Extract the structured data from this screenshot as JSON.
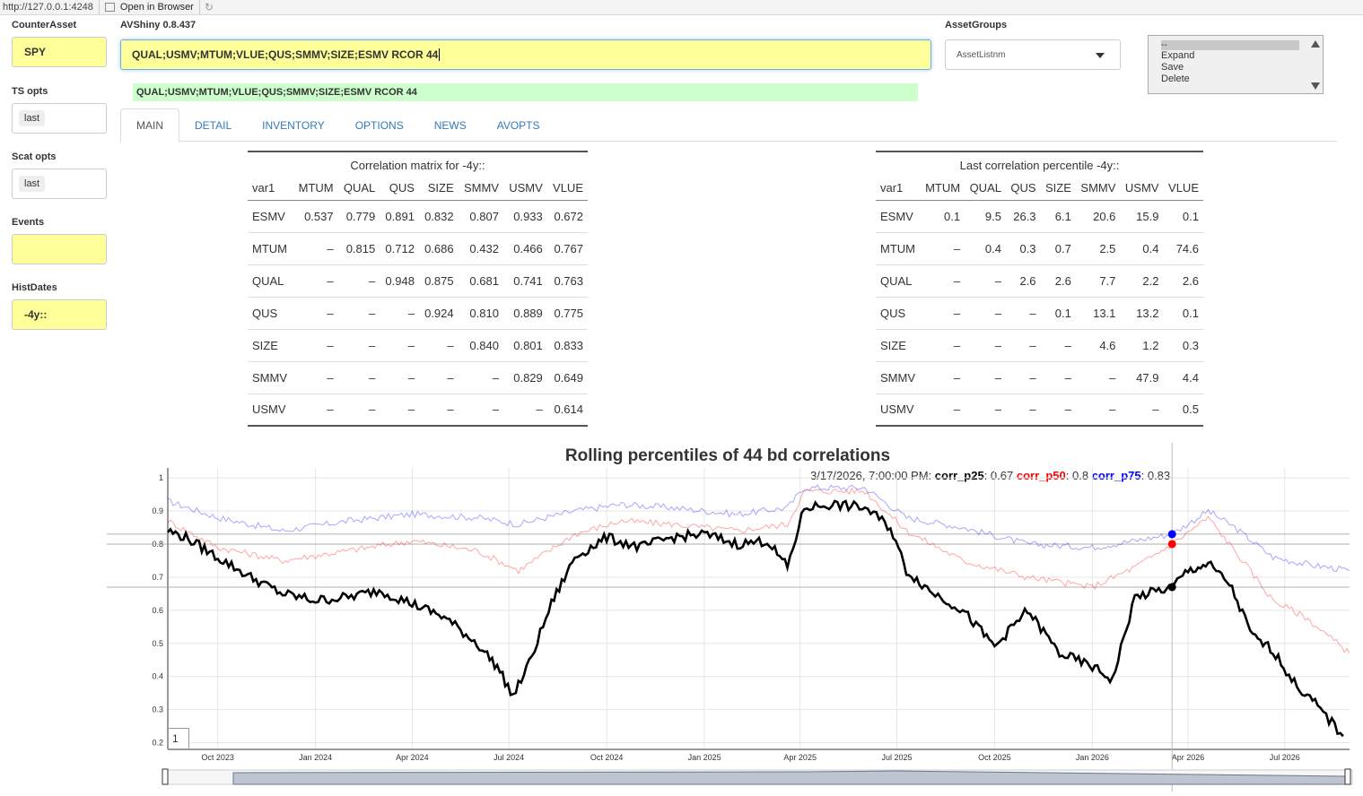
{
  "browser": {
    "url": "http://127.0.0.1:4248",
    "open_in_browser": "Open in Browser"
  },
  "sidebar": {
    "counter_asset_label": "CounterAsset",
    "counter_asset_value": "SPY",
    "ts_opts_label": "TS opts",
    "ts_opts_value": "last",
    "scat_opts_label": "Scat opts",
    "scat_opts_value": "last",
    "events_label": "Events",
    "events_value": "",
    "histdates_label": "HistDates",
    "histdates_value": "-4y::"
  },
  "app": {
    "title": "AVShiny 0.8.437",
    "command": "QUAL;USMV;MTUM;VLUE;QUS;SMMV;SIZE;ESMV RCOR 44",
    "echo": "QUAL;USMV;MTUM;VLUE;QUS;SMMV;SIZE;ESMV RCOR 44"
  },
  "asset_groups": {
    "label": "AssetGroups",
    "selected": "AssetListnm"
  },
  "listbox": {
    "items": [
      "--",
      "Expand",
      "Save",
      "Delete"
    ]
  },
  "tabs": [
    "MAIN",
    "DETAIL",
    "INVENTORY",
    "OPTIONS",
    "NEWS",
    "AVOPTS"
  ],
  "corr_table": {
    "caption": "Correlation matrix for -4y::",
    "headers": [
      "var1",
      "MTUM",
      "QUAL",
      "QUS",
      "SIZE",
      "SMMV",
      "USMV",
      "VLUE"
    ],
    "rows": [
      [
        "ESMV",
        "0.537",
        "0.779",
        "0.891",
        "0.832",
        "0.807",
        "0.933",
        "0.672"
      ],
      [
        "MTUM",
        "–",
        "0.815",
        "0.712",
        "0.686",
        "0.432",
        "0.466",
        "0.767"
      ],
      [
        "QUAL",
        "–",
        "–",
        "0.948",
        "0.875",
        "0.681",
        "0.741",
        "0.763"
      ],
      [
        "QUS",
        "–",
        "–",
        "–",
        "0.924",
        "0.810",
        "0.889",
        "0.775"
      ],
      [
        "SIZE",
        "–",
        "–",
        "–",
        "–",
        "0.840",
        "0.801",
        "0.833"
      ],
      [
        "SMMV",
        "–",
        "–",
        "–",
        "–",
        "–",
        "0.829",
        "0.649"
      ],
      [
        "USMV",
        "–",
        "–",
        "–",
        "–",
        "–",
        "–",
        "0.614"
      ]
    ]
  },
  "pct_table": {
    "caption": "Last correlation percentile -4y::",
    "headers": [
      "var1",
      "MTUM",
      "QUAL",
      "QUS",
      "SIZE",
      "SMMV",
      "USMV",
      "VLUE"
    ],
    "rows": [
      [
        "ESMV",
        "0.1",
        "9.5",
        "26.3",
        "6.1",
        "20.6",
        "15.9",
        "0.1"
      ],
      [
        "MTUM",
        "–",
        "0.4",
        "0.3",
        "0.7",
        "2.5",
        "0.4",
        "74.6"
      ],
      [
        "QUAL",
        "–",
        "–",
        "2.6",
        "2.6",
        "7.7",
        "2.2",
        "2.6"
      ],
      [
        "QUS",
        "–",
        "–",
        "–",
        "0.1",
        "13.1",
        "13.2",
        "0.1"
      ],
      [
        "SIZE",
        "–",
        "–",
        "–",
        "–",
        "4.6",
        "1.2",
        "0.3"
      ],
      [
        "SMMV",
        "–",
        "–",
        "–",
        "–",
        "–",
        "47.9",
        "4.4"
      ],
      [
        "USMV",
        "–",
        "–",
        "–",
        "–",
        "–",
        "–",
        "0.5"
      ]
    ]
  },
  "chart_data": {
    "type": "line",
    "title": "Rolling percentiles of 44 bd correlations",
    "legend": {
      "date": "3/17/2026, 7:00:00 PM:",
      "entries": [
        {
          "name": "corr_p25",
          "value": "0.67",
          "color": "#000000"
        },
        {
          "name": "corr_p50",
          "value": "0.8",
          "color": "#ff0000"
        },
        {
          "name": "corr_p75",
          "value": "0.83",
          "color": "#0000ff"
        }
      ]
    },
    "range_selector_label": "1",
    "ylim": [
      0.18,
      1.03
    ],
    "yticks": [
      1,
      0.9,
      0.8,
      0.7,
      0.6,
      0.5,
      0.4,
      0.3,
      0.2
    ],
    "xticks": [
      "Oct 2023",
      "Jan 2024",
      "Apr 2024",
      "Jul 2024",
      "Oct 2024",
      "Jan 2025",
      "Apr 2025",
      "Jul 2025",
      "Oct 2025",
      "Jan 2026",
      "Apr 2026",
      "Jul 2026"
    ],
    "x_month_range": [
      "2023-08-15",
      "2026-08-31"
    ],
    "highlight_x": "2026-03-17",
    "series": [
      {
        "name": "corr_p25",
        "color": "#000000",
        "x": [
          "2023-08-15",
          "2023-09-01",
          "2023-10-01",
          "2023-11-01",
          "2023-12-01",
          "2024-01-01",
          "2024-02-01",
          "2024-03-01",
          "2024-04-01",
          "2024-05-01",
          "2024-06-01",
          "2024-06-20",
          "2024-07-05",
          "2024-07-20",
          "2024-08-10",
          "2024-09-01",
          "2024-10-01",
          "2024-11-01",
          "2024-12-01",
          "2025-01-01",
          "2025-02-01",
          "2025-03-01",
          "2025-03-20",
          "2025-04-05",
          "2025-05-01",
          "2025-06-01",
          "2025-06-25",
          "2025-07-10",
          "2025-08-01",
          "2025-09-01",
          "2025-10-01",
          "2025-11-01",
          "2025-12-01",
          "2026-01-01",
          "2026-01-20",
          "2026-02-10",
          "2026-03-17",
          "2026-04-01",
          "2026-04-20",
          "2026-05-10",
          "2026-06-01",
          "2026-06-20",
          "2026-07-10",
          "2026-08-01",
          "2026-08-25"
        ],
        "values": [
          0.84,
          0.82,
          0.76,
          0.7,
          0.65,
          0.63,
          0.64,
          0.66,
          0.62,
          0.58,
          0.5,
          0.43,
          0.34,
          0.44,
          0.62,
          0.76,
          0.82,
          0.79,
          0.82,
          0.83,
          0.8,
          0.81,
          0.73,
          0.91,
          0.92,
          0.91,
          0.85,
          0.72,
          0.66,
          0.6,
          0.49,
          0.6,
          0.47,
          0.43,
          0.39,
          0.64,
          0.67,
          0.72,
          0.74,
          0.68,
          0.52,
          0.48,
          0.38,
          0.31,
          0.22
        ]
      },
      {
        "name": "corr_p50",
        "color": "#ff0000",
        "x": [
          "2023-08-15",
          "2023-10-01",
          "2023-12-01",
          "2024-02-01",
          "2024-04-01",
          "2024-06-01",
          "2024-07-10",
          "2024-09-01",
          "2024-10-15",
          "2024-12-01",
          "2025-02-01",
          "2025-03-20",
          "2025-04-05",
          "2025-06-01",
          "2025-07-10",
          "2025-09-01",
          "2025-11-01",
          "2026-01-01",
          "2026-02-10",
          "2026-03-17",
          "2026-04-20",
          "2026-05-15",
          "2026-06-20",
          "2026-07-20",
          "2026-08-31"
        ],
        "values": [
          0.87,
          0.79,
          0.75,
          0.78,
          0.81,
          0.78,
          0.72,
          0.83,
          0.87,
          0.86,
          0.84,
          0.86,
          0.96,
          0.96,
          0.84,
          0.75,
          0.7,
          0.67,
          0.73,
          0.8,
          0.88,
          0.78,
          0.63,
          0.58,
          0.47
        ]
      },
      {
        "name": "corr_p75",
        "color": "#0000ff",
        "x": [
          "2023-08-15",
          "2023-10-01",
          "2023-12-01",
          "2024-02-01",
          "2024-04-01",
          "2024-06-01",
          "2024-07-10",
          "2024-09-01",
          "2024-10-15",
          "2024-12-01",
          "2025-02-01",
          "2025-03-20",
          "2025-04-05",
          "2025-06-01",
          "2025-07-10",
          "2025-09-01",
          "2025-11-01",
          "2026-01-01",
          "2026-02-10",
          "2026-03-17",
          "2026-04-20",
          "2026-05-15",
          "2026-06-20",
          "2026-07-20",
          "2026-08-31"
        ],
        "values": [
          0.93,
          0.88,
          0.84,
          0.87,
          0.89,
          0.88,
          0.86,
          0.9,
          0.92,
          0.91,
          0.89,
          0.91,
          0.97,
          0.97,
          0.88,
          0.85,
          0.8,
          0.79,
          0.81,
          0.83,
          0.9,
          0.85,
          0.76,
          0.74,
          0.72
        ]
      }
    ]
  }
}
